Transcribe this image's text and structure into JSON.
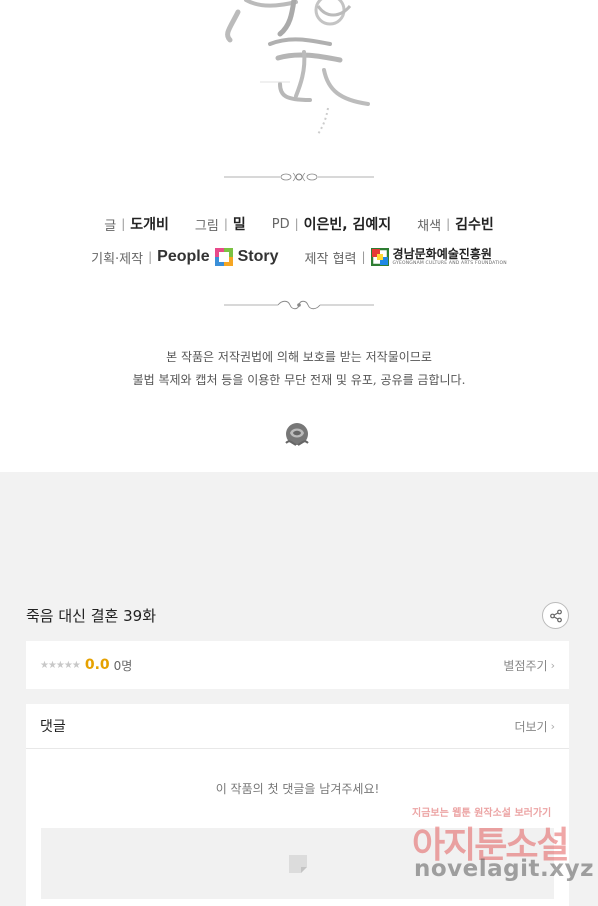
{
  "credits": {
    "writer": {
      "label": "글",
      "name": "도개비"
    },
    "artist": {
      "label": "그림",
      "name": "밀"
    },
    "pd": {
      "label": "PD",
      "name": "이은빈, 김예지"
    },
    "colorist": {
      "label": "채색",
      "name": "김수빈"
    },
    "production": {
      "label": "기획·제작",
      "logo_text_a": "People",
      "logo_text_b": "Story"
    },
    "cooperation": {
      "label": "제작 협력",
      "org_name": "경남문화예술진흥원",
      "org_name_en": "GYEONGNAM CULTURE AND ARTS FOUNDATION"
    },
    "separator": "|"
  },
  "notice": {
    "line1": "본 작품은 저작권법에 의해 보호를 받는 저작물이므로",
    "line2": "불법 복제와 캡처 등을 이용한 무단 전재 및 유포, 공유를 금합니다."
  },
  "episode": {
    "title": "죽음 대신 결혼 39화"
  },
  "rating": {
    "stars": "★★★★★",
    "score": "0.0",
    "count": "0명",
    "rate_link": "별점주기"
  },
  "comments": {
    "title": "댓글",
    "more": "더보기",
    "empty_message": "이 작품의 첫 댓글을 남겨주세요!"
  },
  "watermark": {
    "tagline": "지금보는 웹툰 원작소설 보러가기",
    "site_name": "아지툰소설",
    "url": "novelagit.xyz"
  },
  "icons": {
    "share": "share-icon",
    "chevron": "chevron-right-icon",
    "rose": "rose-icon",
    "comment": "comment-icon"
  },
  "colors": {
    "accent_score": "#e6a100",
    "background": "#f2f2f2"
  }
}
